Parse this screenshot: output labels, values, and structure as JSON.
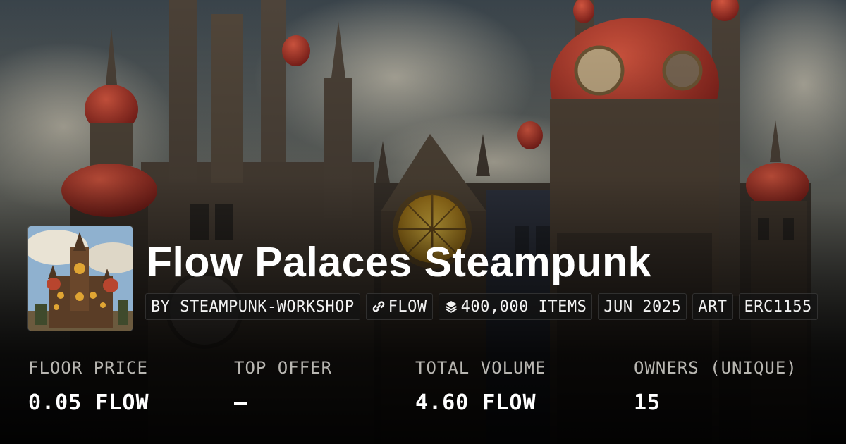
{
  "collection": {
    "title": "Flow Palaces Steampunk",
    "tags": [
      {
        "text": "BY STEAMPUNK-WORKSHOP",
        "icon": ""
      },
      {
        "text": "FLOW",
        "icon": "flow-icon"
      },
      {
        "text": "400,000 ITEMS",
        "icon": "layers-icon"
      },
      {
        "text": "JUN 2025",
        "icon": ""
      },
      {
        "text": "ART",
        "icon": ""
      },
      {
        "text": "ERC1155",
        "icon": ""
      }
    ]
  },
  "stats": [
    {
      "label": "FLOOR PRICE",
      "value": "0.05 FLOW"
    },
    {
      "label": "TOP OFFER",
      "value": "—"
    },
    {
      "label": "TOTAL VOLUME",
      "value": "4.60 FLOW"
    },
    {
      "label": "OWNERS (UNIQUE)",
      "value": "15"
    }
  ],
  "colors": {
    "text": "#ffffff",
    "muted_label": "#b9b7b2",
    "dome_red": "#a8302a",
    "clock_gold": "#d9a72a"
  }
}
